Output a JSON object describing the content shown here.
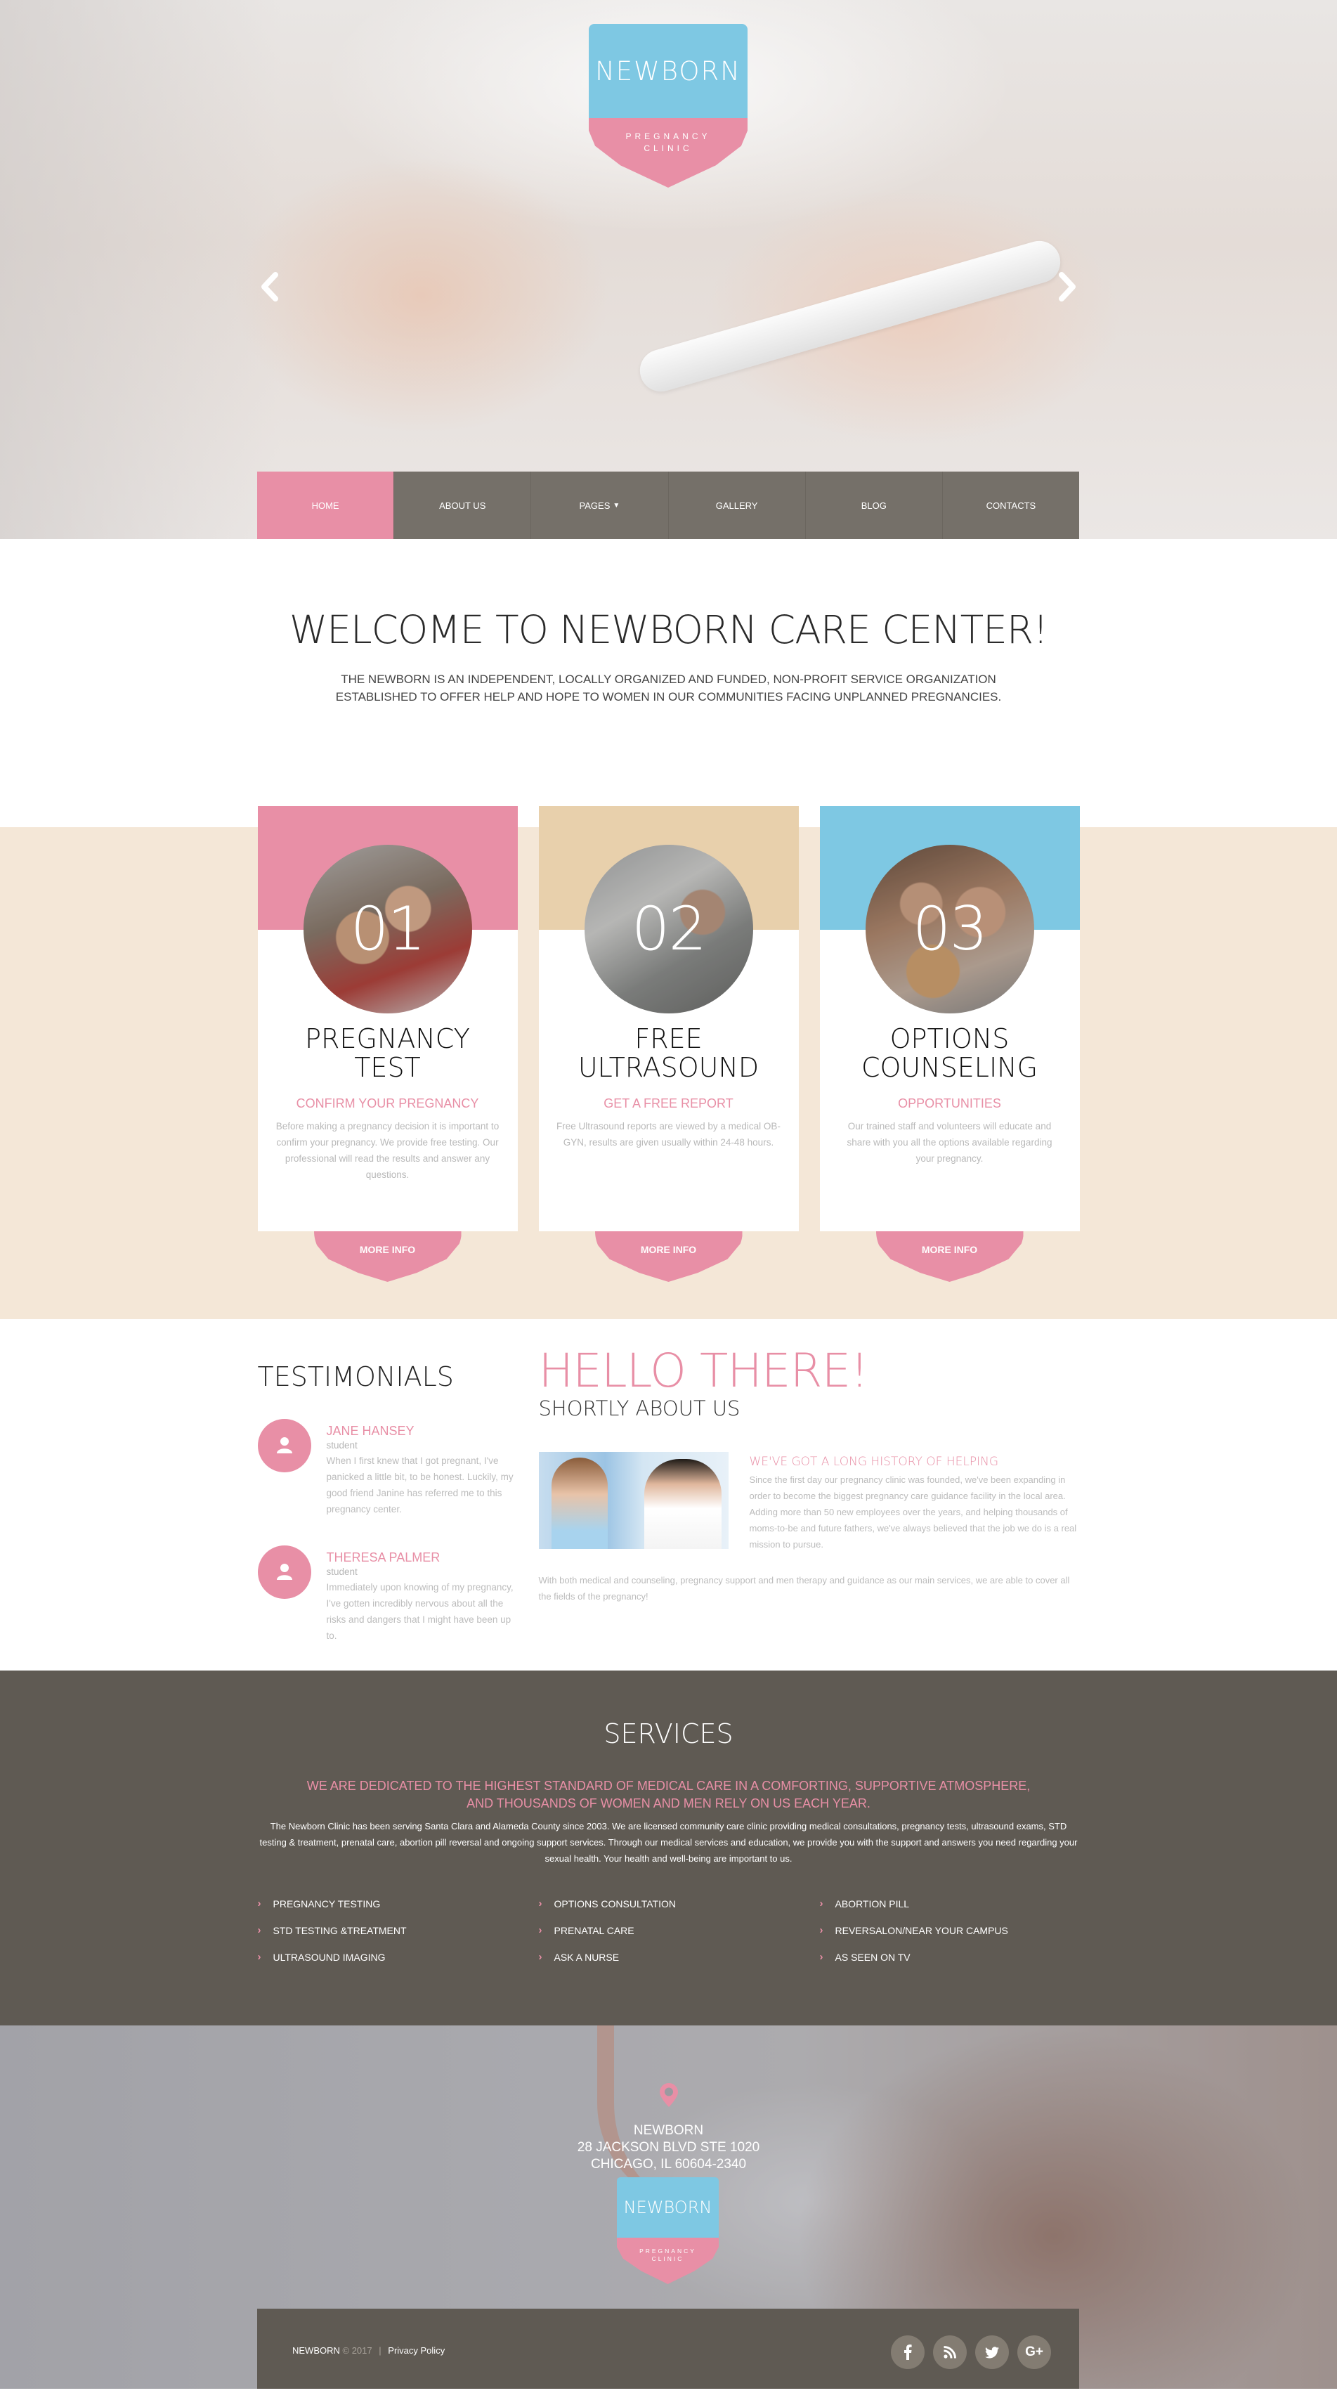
{
  "colors": {
    "pink": "#e88fa6",
    "blue": "#7ec8e3",
    "tan": "#e8d0ac",
    "beige_band": "#f4e7d7",
    "dark_taupe": "#5f5a53",
    "nav_gray": "#757069"
  },
  "logo": {
    "name": "NEWBORN",
    "tagline_line1": "PREGNANCY",
    "tagline_line2": "CLINIC"
  },
  "slider": {
    "prev_icon": "chevron-left-icon",
    "next_icon": "chevron-right-icon"
  },
  "nav": {
    "items": [
      {
        "label": "HOME",
        "active": true
      },
      {
        "label": "ABOUT US"
      },
      {
        "label": "PAGES",
        "has_dropdown": true
      },
      {
        "label": "GALLERY"
      },
      {
        "label": "BLOG"
      },
      {
        "label": "CONTACTS"
      }
    ],
    "dropdown_glyph": "⌄"
  },
  "welcome": {
    "title": "WELCOME TO NEWBORN CARE CENTER!",
    "line1": "THE NEWBORN IS AN INDEPENDENT, LOCALLY ORGANIZED AND FUNDED, NON-PROFIT SERVICE ORGANIZATION",
    "line2": "ESTABLISHED TO OFFER HELP AND HOPE TO WOMEN IN OUR COMMUNITIES FACING UNPLANNED PREGNANCIES."
  },
  "features": [
    {
      "number": "01",
      "accent": "#e88fa6",
      "title_line1": "PREGNANCY",
      "title_line2": "TEST",
      "subtitle": "CONFIRM YOUR PREGNANCY",
      "text": "Before making a pregnancy decision it is important to confirm your pregnancy. We provide free testing. Our professional will read the results and answer any questions.",
      "button": "MORE INFO"
    },
    {
      "number": "02",
      "accent": "#e8d0ac",
      "title_line1": "FREE",
      "title_line2": "ULTRASOUND",
      "subtitle": "GET A FREE REPORT",
      "text": "Free Ultrasound reports are viewed by a medical OB-GYN, results are given usually within 24-48 hours.",
      "button": "MORE INFO"
    },
    {
      "number": "03",
      "accent": "#7ec8e3",
      "title_line1": "OPTIONS",
      "title_line2": "COUNSELING",
      "subtitle": "OPPORTUNITIES",
      "text": "Our trained staff and volunteers will educate and share with you all the options available regarding your pregnancy.",
      "button": "MORE INFO"
    }
  ],
  "testimonials": {
    "title": "TESTIMONIALS",
    "items": [
      {
        "name": "JANE HANSEY",
        "role": "student",
        "text": "When I first knew that I got pregnant, I've panicked a little bit, to be honest. Luckily, my good friend Janine has referred me to this pregnancy center."
      },
      {
        "name": "THERESA PALMER",
        "role": "student",
        "text": "Immediately upon knowing of my pregnancy, I've gotten incredibly nervous about all the risks and dangers that I might have been up to."
      }
    ]
  },
  "about": {
    "title": "HELLO THERE!",
    "subtitle": "SHORTLY ABOUT US",
    "heading": "WE'VE GOT A LONG HISTORY OF HELPING",
    "text": "Since the first day our pregnancy clinic was founded, we've been expanding in order to become the biggest pregnancy care guidance facility in the local area. Adding more than 50 new employees over the years, and helping thousands of moms-to-be and future fathers, we've always believed that the job we do is a real mission to pursue.",
    "footer_text": "With both medical and counseling, pregnancy support and men therapy and guidance as our main services, we are able to cover all the fields of the pregnancy!"
  },
  "services": {
    "title": "SERVICES",
    "lead_line1": "WE ARE DEDICATED TO THE HIGHEST STANDARD OF MEDICAL CARE IN A COMFORTING, SUPPORTIVE ATMOSPHERE,",
    "lead_line2": "AND THOUSANDS OF WOMEN AND MEN RELY ON US EACH YEAR.",
    "description": "The Newborn Clinic has been serving Santa Clara and Alameda County since 2003. We are licensed community care clinic providing medical consultations, pregnancy tests, ultrasound exams, STD testing & treatment, prenatal care, abortion pill reversal and ongoing support services. Through our medical services and education, we provide you with the support and answers you need regarding your sexual health. Your health and well-being are important to us.",
    "items": [
      "PREGNANCY TESTING",
      "OPTIONS CONSULTATION",
      "ABORTION PILL",
      "STD TESTING &TREATMENT",
      "PRENATAL CARE",
      "REVERSALON/NEAR YOUR CAMPUS",
      "ULTRASOUND IMAGING",
      "ASK A NURSE",
      "AS SEEN ON TV"
    ],
    "bullet_glyph": "›"
  },
  "contact": {
    "name": "NEWBORN",
    "address_line1": "28 JACKSON BLVD STE 1020",
    "address_line2": "CHICAGO, IL 60604-2340"
  },
  "footer": {
    "brand": "NEWBORN",
    "copyright": "© 2017",
    "separator": "|",
    "privacy": "Privacy Policy",
    "socials": [
      {
        "name": "facebook",
        "glyph": "f"
      },
      {
        "name": "rss",
        "glyph": "rss"
      },
      {
        "name": "twitter",
        "glyph": "tw"
      },
      {
        "name": "google-plus",
        "glyph": "G+"
      }
    ]
  }
}
